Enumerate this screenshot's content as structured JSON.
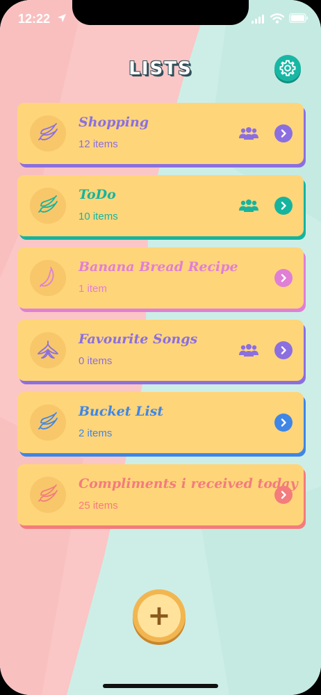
{
  "status_bar": {
    "time": "12:22"
  },
  "header": {
    "title": "LISTS",
    "settings_icon": "gear-icon"
  },
  "lists": [
    {
      "name": "Shopping",
      "count": "12 items",
      "shared": true,
      "accent": "#8b6fe0",
      "icon": "banana-bunch-icon"
    },
    {
      "name": "ToDo",
      "count": "10 items",
      "shared": true,
      "accent": "#16b49e",
      "icon": "banana-bunch-icon"
    },
    {
      "name": "Banana Bread Recipe",
      "count": "1 item",
      "shared": false,
      "accent": "#e07fd6",
      "icon": "single-banana-icon"
    },
    {
      "name": "Favourite Songs",
      "count": "0 items",
      "shared": true,
      "accent": "#8b6fe0",
      "icon": "banana-peel-icon"
    },
    {
      "name": "Bucket List",
      "count": "2 items",
      "shared": false,
      "accent": "#3f86e6",
      "icon": "banana-bunch-icon"
    },
    {
      "name": "Compliments i received today",
      "count": "25 items",
      "shared": false,
      "accent": "#f37c7c",
      "icon": "banana-bunch-icon"
    }
  ],
  "colors": {
    "card": "#ffd57a",
    "bg_pink": "#fbc6c6",
    "bg_mint": "#cdeee7",
    "teal": "#18b7a4"
  },
  "fab": {
    "label": "+"
  }
}
